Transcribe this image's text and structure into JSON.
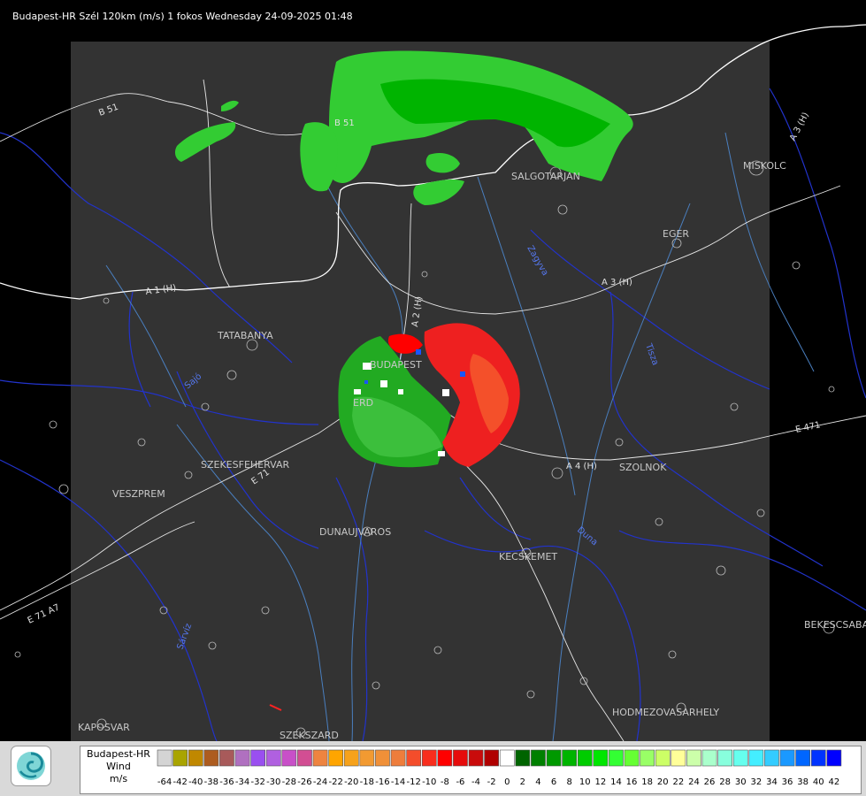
{
  "title": "Budapest-HR Szél 120km (m/s) 1 fokos Wednesday 24-09-2025 01:48",
  "cities": [
    {
      "name": "SALGOTARJAN"
    },
    {
      "name": "MISKOLC"
    },
    {
      "name": "EGER"
    },
    {
      "name": "TATABANYA"
    },
    {
      "name": "BUDAPEST"
    },
    {
      "name": "ERD"
    },
    {
      "name": "SZEKESFEHERVAR"
    },
    {
      "name": "VESZPREM"
    },
    {
      "name": "DUNAUJVAROS"
    },
    {
      "name": "KECSKEMET"
    },
    {
      "name": "SZOLNOK"
    },
    {
      "name": "BEKESCSABA"
    },
    {
      "name": "HODMEZOVASARHELY"
    },
    {
      "name": "KAPOSVAR"
    },
    {
      "name": "SZEKSZARD"
    }
  ],
  "roads": [
    {
      "name": "B 51"
    },
    {
      "name": "B 51"
    },
    {
      "name": "A 3 (H)"
    },
    {
      "name": "A 3 (H)"
    },
    {
      "name": "A 2 (H)"
    },
    {
      "name": "A 1 (H)"
    },
    {
      "name": "A 4 (H)"
    },
    {
      "name": "E 471"
    },
    {
      "name": "E 71"
    },
    {
      "name": "E 71 A7"
    }
  ],
  "rivers": [
    {
      "name": "Tisza"
    },
    {
      "name": "Zagyva"
    },
    {
      "name": "Duna"
    },
    {
      "name": "Sárvíz"
    },
    {
      "name": "Sajó"
    }
  ],
  "legend": {
    "line1": "Budapest-HR",
    "line2": "Wind",
    "line3": "m/s",
    "ticks": [
      "-64",
      "-42",
      "-40",
      "-38",
      "-36",
      "-34",
      "-32",
      "-30",
      "-28",
      "-26",
      "-24",
      "-22",
      "-20",
      "-18",
      "-16",
      "-14",
      "-12",
      "-10",
      "-8",
      "-6",
      "-4",
      "-2",
      "0",
      "2",
      "4",
      "6",
      "8",
      "10",
      "12",
      "14",
      "16",
      "18",
      "20",
      "22",
      "24",
      "26",
      "28",
      "30",
      "32",
      "34",
      "36",
      "38",
      "40",
      "42"
    ],
    "colors": [
      "#d4d4d4",
      "#a9a400",
      "#c08800",
      "#ad5c1f",
      "#a85a5a",
      "#b070c0",
      "#9a4ff0",
      "#b060e0",
      "#c850c8",
      "#d24e93",
      "#ee8440",
      "#ffa500",
      "#f6a21b",
      "#f29a31",
      "#f09038",
      "#ee7d3c",
      "#f44d2b",
      "#f82d1d",
      "#ff0000",
      "#e60b0b",
      "#c90b0b",
      "#b00000",
      "#ffffff",
      "#006400",
      "#008000",
      "#009900",
      "#00b400",
      "#00cc00",
      "#00e600",
      "#33ff33",
      "#66ff33",
      "#99ff66",
      "#ccff66",
      "#ffff99",
      "#ccffaa",
      "#aaffcc",
      "#88ffdd",
      "#66ffee",
      "#44eeff",
      "#33ccff",
      "#1a99ff",
      "#0066ff",
      "#0033ff",
      "#0000ff"
    ]
  }
}
